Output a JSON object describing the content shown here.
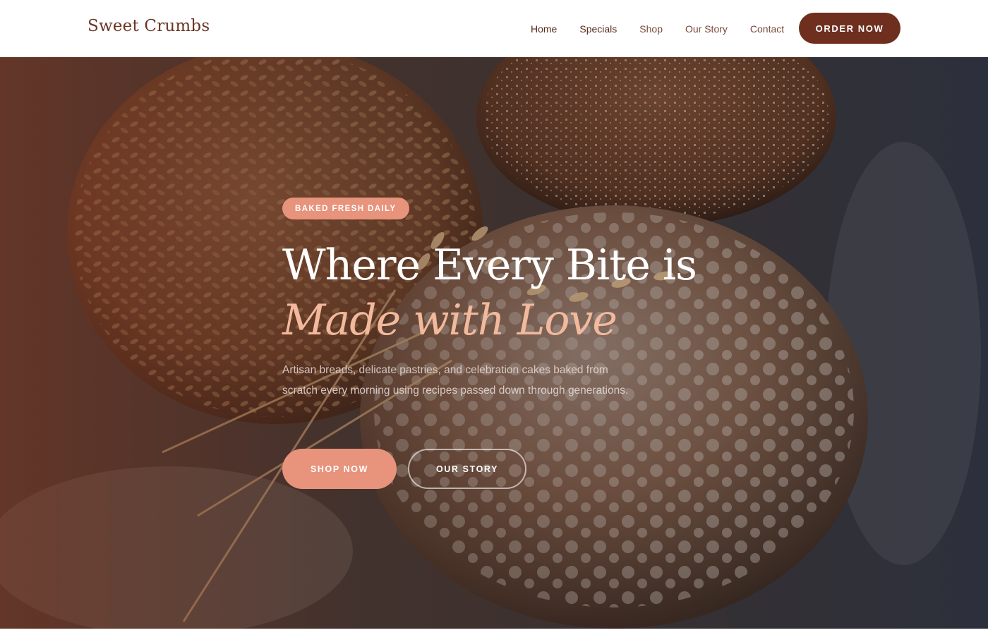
{
  "header": {
    "logo": "Sweet Crumbs",
    "nav": [
      {
        "label": "Home"
      },
      {
        "label": "Specials"
      },
      {
        "label": "Shop"
      },
      {
        "label": "Our Story"
      },
      {
        "label": "Contact"
      }
    ],
    "cta_label": "ORDER NOW"
  },
  "hero": {
    "badge": "BAKED FRESH DAILY",
    "headline_line1": "Where Every Bite is",
    "headline_line2": "Made with Love",
    "description": "Artisan breads, delicate pastries, and celebration cakes baked from scratch every morning using recipes passed down through generations.",
    "primary_button": "SHOP NOW",
    "secondary_button": "OUR STORY",
    "background_image": "bread-loaves-with-wheat-image"
  },
  "colors": {
    "brand_dark": "#6e2f1f",
    "accent": "#e8937c",
    "accent_text": "#f2b99c"
  }
}
